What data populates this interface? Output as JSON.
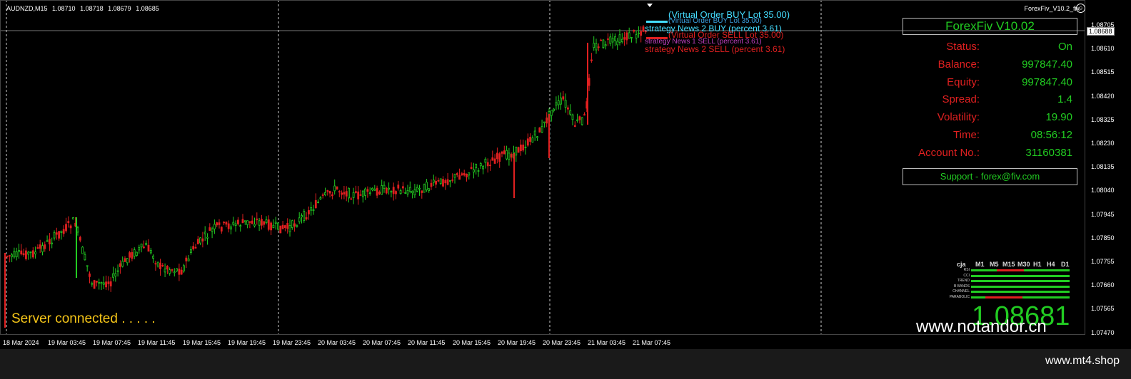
{
  "header": {
    "symbol": "AUDNZD,M15",
    "open": "1.08710",
    "high": "1.08718",
    "low": "1.08679",
    "close": "1.08685"
  },
  "ea_tag": "ForexFiv_V10.2_fix",
  "current_price_tag": "1.08688",
  "price_ticks": [
    "1.08705",
    "1.08610",
    "1.08515",
    "1.08420",
    "1.08325",
    "1.08230",
    "1.08135",
    "1.08040",
    "1.07945",
    "1.07850",
    "1.07755",
    "1.07660",
    "1.07565",
    "1.07470"
  ],
  "time_labels": [
    "18 Mar 2024",
    "19 Mar 03:45",
    "19 Mar 07:45",
    "19 Mar 11:45",
    "19 Mar 15:45",
    "19 Mar 19:45",
    "19 Mar 23:45",
    "20 Mar 03:45",
    "20 Mar 07:45",
    "20 Mar 11:45",
    "20 Mar 15:45",
    "20 Mar 19:45",
    "20 Mar 23:45",
    "21 Mar 03:45",
    "21 Mar 07:45"
  ],
  "orders": {
    "buy_virtual_big": "(Virtual Order BUY Lot 35.00)",
    "buy_virtual_small": "(Virtual Order BUY Lot 35.00)",
    "buy_strategy": "strategy News 2 BUY (percent 3.61)",
    "sell_virtual": "(Virtual Order SELL Lot 35.00)",
    "sell_strategy_1": "strategy News 1 SELL (percent 3.61)",
    "sell_strategy_2": "strategy News 2 SELL (percent 3.61)"
  },
  "panel": {
    "title": "ForexFiv  V10.02",
    "rows": [
      {
        "label": "Status:",
        "value": "On"
      },
      {
        "label": "Balance:",
        "value": "997847.40"
      },
      {
        "label": "Equity:",
        "value": "997847.40"
      },
      {
        "label": "Spread:",
        "value": "1.4"
      },
      {
        "label": "Volatility:",
        "value": "19.90"
      },
      {
        "label": "Time:",
        "value": "08:56:12"
      },
      {
        "label": "Account No.:",
        "value": "31160381"
      }
    ],
    "support": "Support - forex@fiv.com"
  },
  "timeframes": {
    "head_label": "cja",
    "columns": [
      "M1",
      "M5",
      "M15",
      "M30",
      "H1",
      "H4",
      "D1"
    ],
    "indicators": [
      "RSI",
      "CCI",
      "TREND",
      "B BANDS",
      "CHANNEL",
      "PARABOLIC"
    ]
  },
  "status_text": "Server connected . . . . .",
  "big_price": "1.08681",
  "watermark": "www.notandor.cn",
  "footer_watermark": "www.mt4.shop",
  "colors": {
    "bull": "#22cc22",
    "bear": "#e02020",
    "panel_green": "#22cc22",
    "panel_red": "#e02020"
  }
}
